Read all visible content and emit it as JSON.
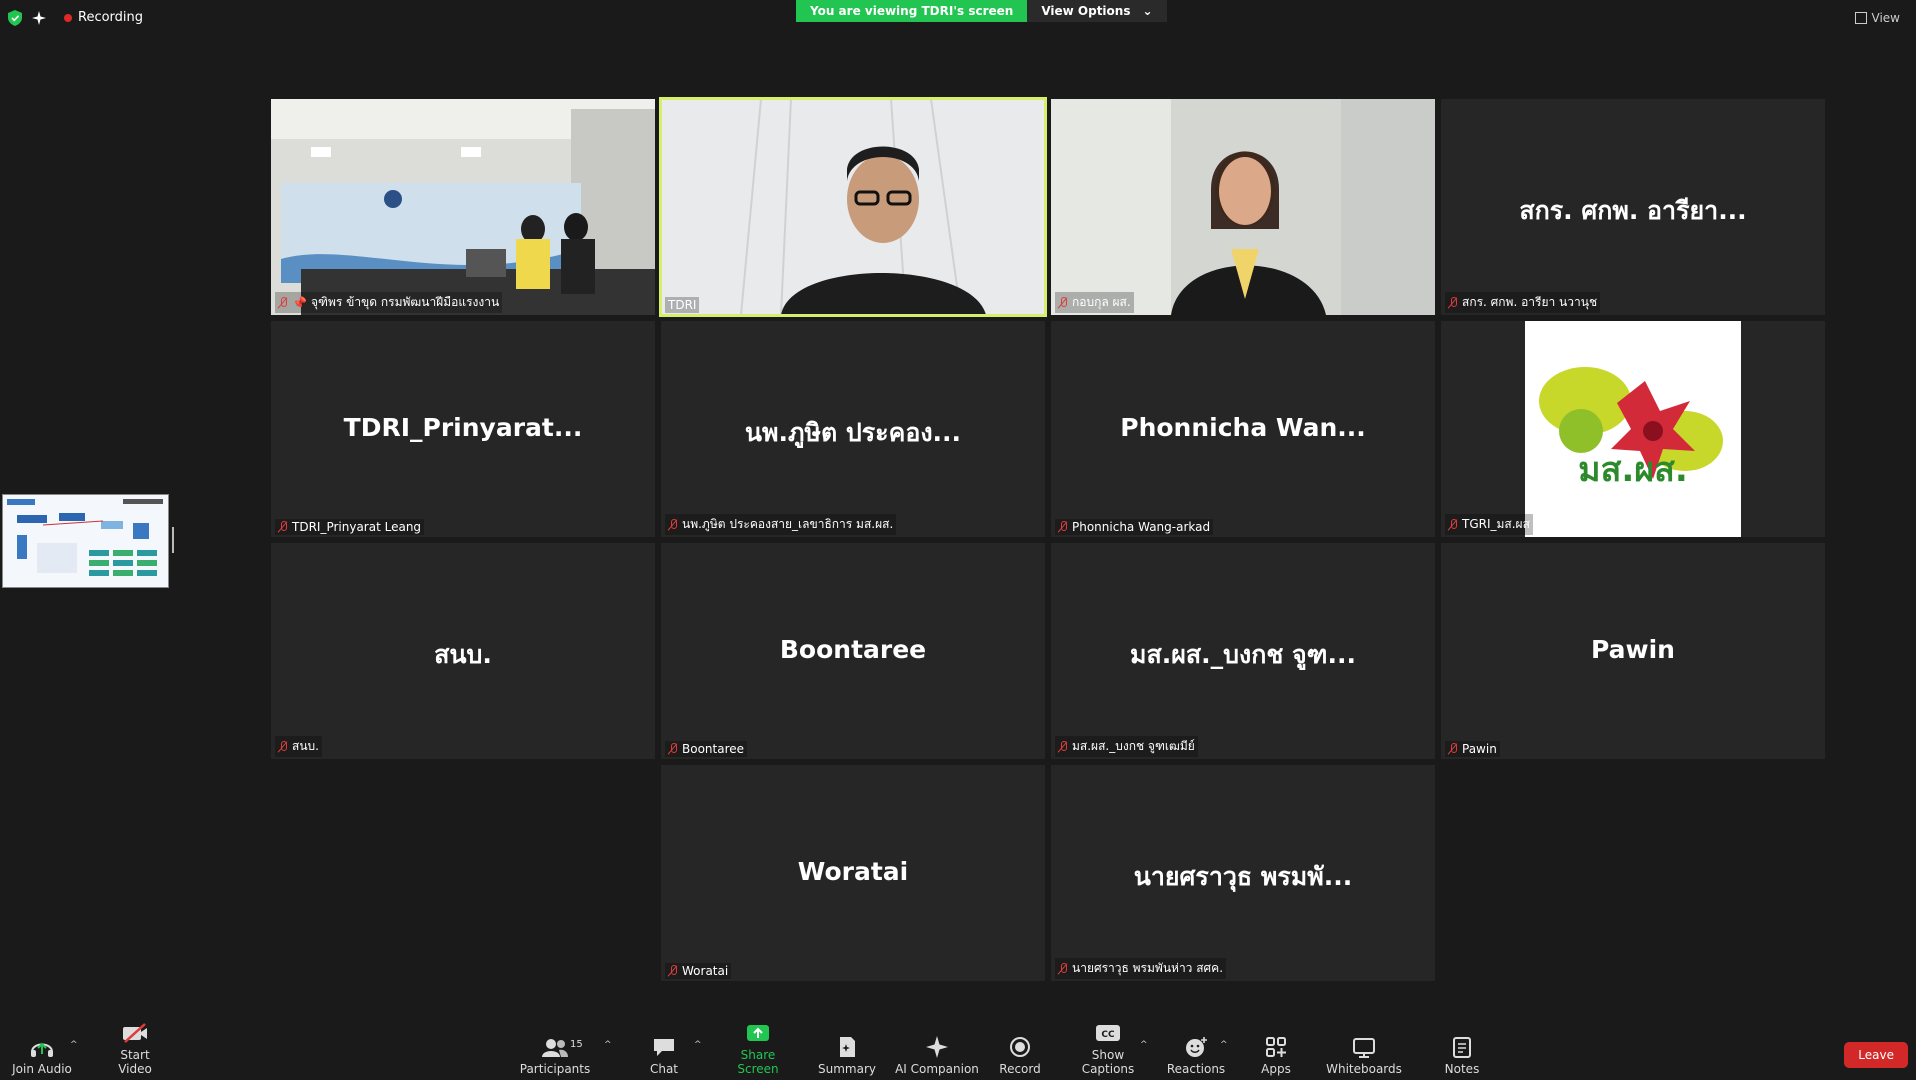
{
  "top_bar": {
    "recording_label": "Recording",
    "share_banner": "You are viewing TDRI's screen",
    "view_options_label": "View Options",
    "view_label": "View"
  },
  "participants": [
    {
      "name": "จุฑิพร ข้าขุด กรมพัฒนาฝีมือแรงงาน",
      "center": "",
      "video": "room"
    },
    {
      "name": "TDRI",
      "center": "",
      "video": "man"
    },
    {
      "name": "กอบกุล ผส.",
      "center": "",
      "video": "woman"
    },
    {
      "name": "สกร. ศกพ. อารียา นวานุช",
      "center": "สกร. ศกพ. อารียา..."
    },
    {
      "name": "TDRI_Prinyarat Leang",
      "center": "TDRI_Prinyarat..."
    },
    {
      "name": "นพ.ภูษิต ประคองสาย_เลขาธิการ มส.ผส.",
      "center": "นพ.ภูษิต ประคอง..."
    },
    {
      "name": "Phonnicha Wang-arkad",
      "center": "Phonnicha  Wan..."
    },
    {
      "name": "TGRI_มส.ผส",
      "center": "",
      "video": "logo",
      "logo_text": "มส.ผส."
    },
    {
      "name": "สนบ.",
      "center": "สนบ."
    },
    {
      "name": "Boontaree",
      "center": "Boontaree"
    },
    {
      "name": "มส.ผส._บงกช จูฑเฒมีย์",
      "center": "มส.ผส._บงกช จูฑ..."
    },
    {
      "name": "Pawin",
      "center": "Pawin"
    },
    {
      "name": "Woratai",
      "center": "Woratai"
    },
    {
      "name": "นายศราวุธ พรมพันห่าว สศค.",
      "center": "นายศราวุธ พรมพั..."
    }
  ],
  "toolbar": {
    "join_audio": "Join Audio",
    "start_video": "Start Video",
    "participants": "Participants",
    "participants_count": "15",
    "chat": "Chat",
    "share_screen": "Share Screen",
    "summary": "Summary",
    "ai_companion": "AI Companion",
    "record": "Record",
    "show_captions": "Show Captions",
    "captions_icon_text": "CC",
    "reactions": "Reactions",
    "apps": "Apps",
    "whiteboards": "Whiteboards",
    "notes": "Notes",
    "leave": "Leave"
  },
  "colors": {
    "share_banner": "#23c552",
    "active_speaker": "#d6ef6a",
    "leave": "#d22828",
    "share_screen_icon": "#23c552"
  }
}
